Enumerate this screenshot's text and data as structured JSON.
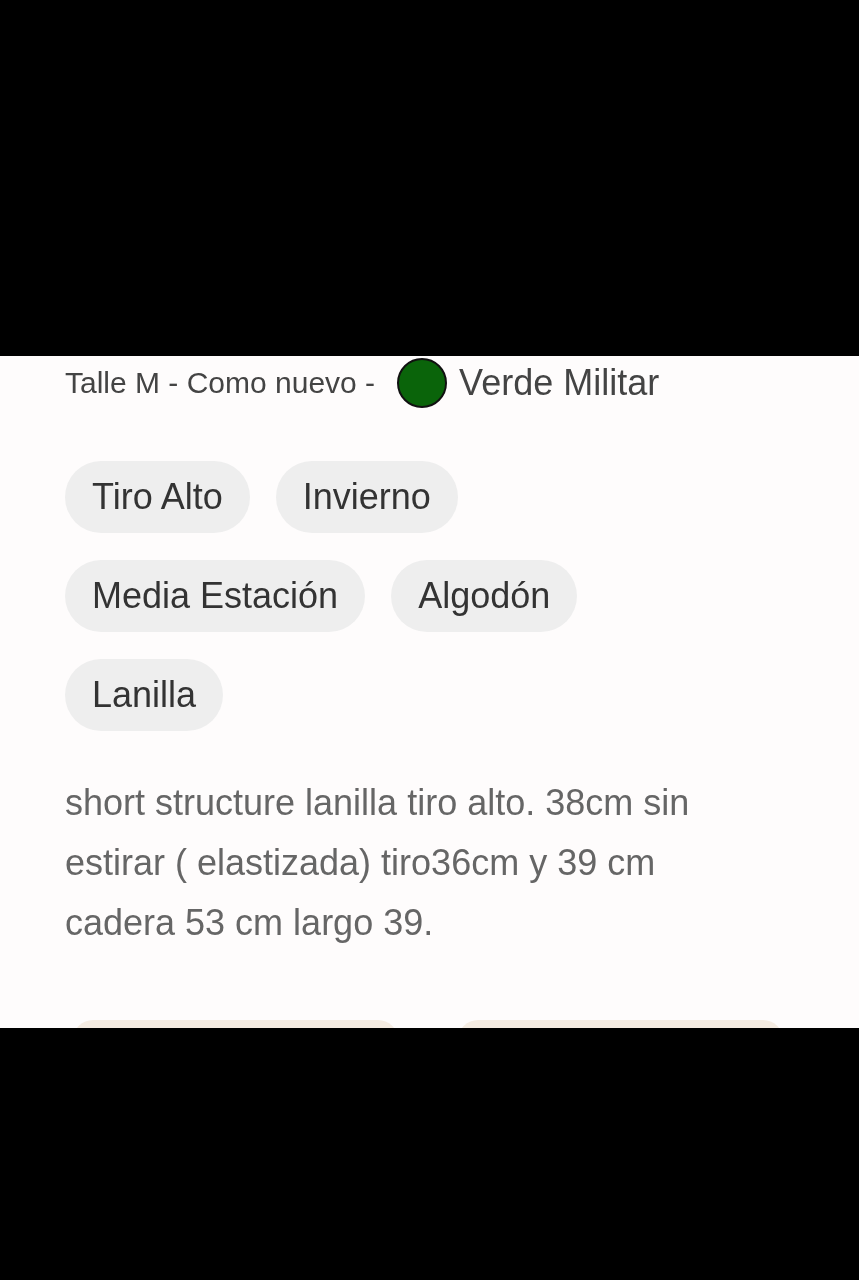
{
  "summary": {
    "size_condition": "Talle M - Como nuevo -",
    "color": {
      "name": "Verde Militar",
      "color": "#0a640a"
    }
  },
  "tags": [
    "Tiro Alto",
    "Invierno",
    "Media Estación",
    "Algodón",
    "Lanilla"
  ],
  "description": "short structure lanilla tiro alto. 38cm sin estirar ( elastizada) tiro36cm y 39 cm cadera 53 cm largo 39."
}
